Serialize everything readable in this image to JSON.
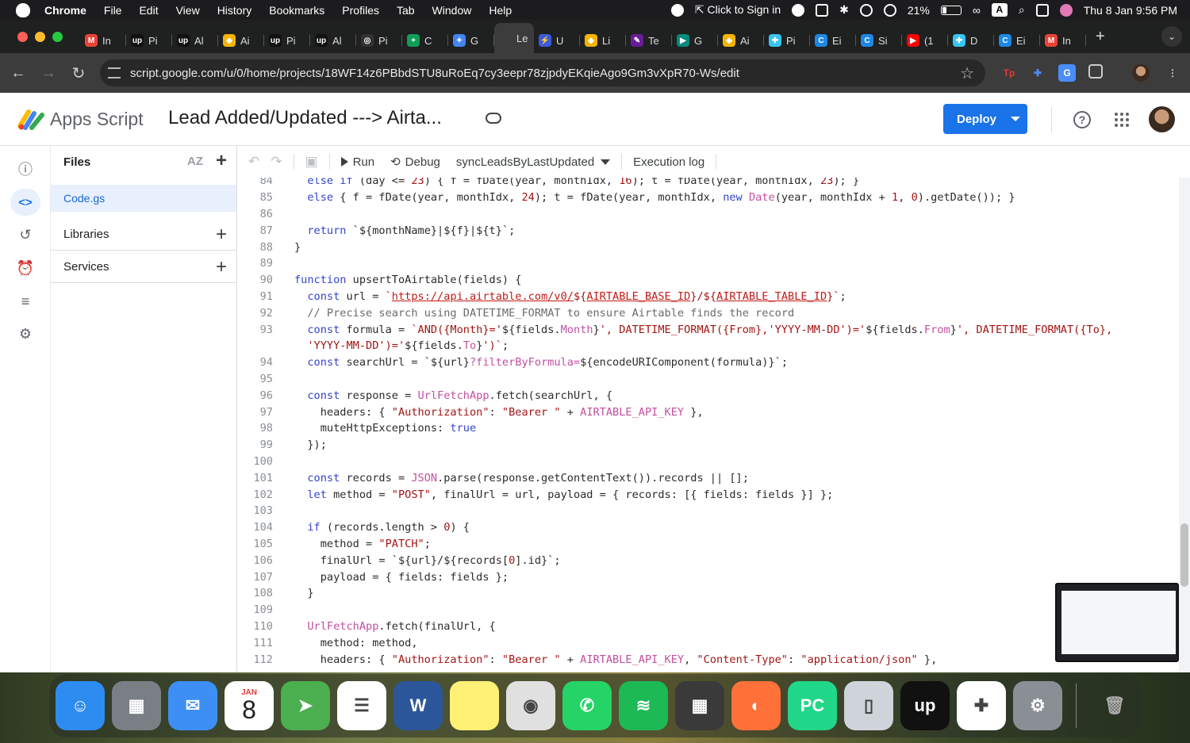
{
  "menubar": {
    "app": "Chrome",
    "items": [
      "File",
      "Edit",
      "View",
      "History",
      "Bookmarks",
      "Profiles",
      "Tab",
      "Window",
      "Help"
    ],
    "sign_in": "Click to Sign in",
    "battery": "21%",
    "input_source": "A",
    "datetime": "Thu 8 Jan  9:56 PM"
  },
  "tabs": [
    {
      "label": "In",
      "icon": "gmail-icon",
      "color": "#ea4335",
      "glyph": "M"
    },
    {
      "label": "Pi",
      "icon": "upwork-icon",
      "color": "#111111",
      "glyph": "up"
    },
    {
      "label": "Al",
      "icon": "upwork-icon",
      "color": "#111111",
      "glyph": "up"
    },
    {
      "label": "Ai",
      "icon": "airtable-icon",
      "color": "#f4b400",
      "glyph": "◆"
    },
    {
      "label": "Pi",
      "icon": "upwork-icon",
      "color": "#111111",
      "glyph": "up"
    },
    {
      "label": "Al",
      "icon": "upwork-icon",
      "color": "#111111",
      "glyph": "up"
    },
    {
      "label": "Pi",
      "icon": "openai-icon",
      "color": "#333333",
      "glyph": "◎"
    },
    {
      "label": "C",
      "icon": "sheets-icon",
      "color": "#0f9d58",
      "glyph": "+"
    },
    {
      "label": "G",
      "icon": "gemini-icon",
      "color": "#4285f4",
      "glyph": "✦"
    },
    {
      "label": "Le",
      "icon": "appsscript-icon",
      "color": "#3c3c3c",
      "glyph": ""
    },
    {
      "label": "U",
      "icon": "zapier-icon",
      "color": "#3b5bdb",
      "glyph": "⚡"
    },
    {
      "label": "Li",
      "icon": "airtable-icon",
      "color": "#f4b400",
      "glyph": "◆"
    },
    {
      "label": "Te",
      "icon": "make-icon",
      "color": "#6a1b9a",
      "glyph": "✎"
    },
    {
      "label": "G",
      "icon": "meet-icon",
      "color": "#00897b",
      "glyph": "▶"
    },
    {
      "label": "Ai",
      "icon": "airtable-icon",
      "color": "#f4b400",
      "glyph": "◆"
    },
    {
      "label": "Pi",
      "icon": "slack-icon",
      "color": "#36c5f0",
      "glyph": "✚"
    },
    {
      "label": "Ei",
      "icon": "chatgpt-icon",
      "color": "#1e88e5",
      "glyph": "C"
    },
    {
      "label": "Si",
      "icon": "chatgpt-icon",
      "color": "#1e88e5",
      "glyph": "C"
    },
    {
      "label": "(1",
      "icon": "youtube-icon",
      "color": "#ff0000",
      "glyph": "▶"
    },
    {
      "label": "D",
      "icon": "slack-icon",
      "color": "#36c5f0",
      "glyph": "✚"
    },
    {
      "label": "Ei",
      "icon": "chatgpt-icon",
      "color": "#1e88e5",
      "glyph": "C"
    },
    {
      "label": "In",
      "icon": "gmail-icon",
      "color": "#ea4335",
      "glyph": "M"
    }
  ],
  "address": {
    "url": "script.google.com/u/0/home/projects/18WF14z6PBbdSTU8uRoEq7cy3eepr78zjpdyEKqieAgo9Gm3vXpR70-Ws/edit"
  },
  "header": {
    "brand": "Apps Script",
    "project_title": "Lead Added/Updated ---> Airta...",
    "deploy_label": "Deploy"
  },
  "files_panel": {
    "title": "Files",
    "file": "Code.gs",
    "libraries": "Libraries",
    "services": "Services"
  },
  "editor_toolbar": {
    "run": "Run",
    "debug": "Debug",
    "function": "syncLeadsByLastUpdated",
    "exec_log": "Execution log"
  },
  "code_lines": [
    {
      "n": "84",
      "html": "  <span class='kw'>else if</span> (day &lt;= <span class='str'>23</span>) { f = fDate(year, monthIdx, <span class='str'>16</span>); t = fDate(year, monthIdx, <span class='str'>23</span>); }"
    },
    {
      "n": "85",
      "html": "  <span class='kw'>else</span> { f = fDate(year, monthIdx, <span class='str'>24</span>); t = fDate(year, monthIdx, <span class='kw'>new</span> <span class='fn'>Date</span>(year, monthIdx + <span class='str'>1</span>, <span class='str'>0</span>).getDate()); }"
    },
    {
      "n": "86",
      "html": ""
    },
    {
      "n": "87",
      "html": "  <span class='kw'>return</span> `${monthName}|${f}|${t}`;"
    },
    {
      "n": "88",
      "html": "}"
    },
    {
      "n": "89",
      "html": ""
    },
    {
      "n": "90",
      "html": "<span class='kw'>function</span> upsertToAirtable(fields) {"
    },
    {
      "n": "91",
      "html": "  <span class='kw'>const</span> url = <span class='str'>`</span><span class='link'>https://api.airtable.com/v0/</span><span class='str'>${</span><span class='link'>AIRTABLE_BASE_ID</span><span class='str'>}/${</span><span class='link'>AIRTABLE_TABLE_ID</span><span class='str'>}`</span>;"
    },
    {
      "n": "92",
      "html": "  <span class='com'>// Precise search using DATETIME_FORMAT to ensure Airtable finds the record</span>"
    },
    {
      "n": "93",
      "html": "  <span class='kw'>const</span> formula = <span class='str'>`AND({Month}='</span>${fields.<span class='fn'>Month</span>}<span class='str'>', DATETIME_FORMAT({From},'YYYY-MM-DD')='</span>${fields.<span class='fn'>From</span>}<span class='str'>', DATETIME_FORMAT({To},</span>"
    },
    {
      "n": "",
      "html": "  <span class='str'>'YYYY-MM-DD')='</span>${fields.<span class='fn'>To</span>}<span class='str'>')`</span>;"
    },
    {
      "n": "94",
      "html": "  <span class='kw'>const</span> searchUrl = `${url}<span class='fn'>?filterByFormula=</span>${encodeURIComponent(formula)}`;"
    },
    {
      "n": "95",
      "html": ""
    },
    {
      "n": "96",
      "html": "  <span class='kw'>const</span> response = <span class='fn'>UrlFetchApp</span>.fetch(searchUrl, {"
    },
    {
      "n": "97",
      "html": "    headers: { <span class='str'>\"Authorization\"</span>: <span class='str'>\"Bearer \"</span> + <span class='fn'>AIRTABLE_API_KEY</span> },"
    },
    {
      "n": "98",
      "html": "    muteHttpExceptions: <span class='kw'>true</span>"
    },
    {
      "n": "99",
      "html": "  });"
    },
    {
      "n": "100",
      "html": ""
    },
    {
      "n": "101",
      "html": "  <span class='kw'>const</span> records = <span class='fn'>JSON</span>.parse(response.getContentText()).records || [];"
    },
    {
      "n": "102",
      "html": "  <span class='kw'>let</span> method = <span class='str'>\"POST\"</span>, finalUrl = url, payload = { records: [{ fields: fields }] };"
    },
    {
      "n": "103",
      "html": ""
    },
    {
      "n": "104",
      "html": "  <span class='kw'>if</span> (records.length &gt; <span class='str'>0</span>) {"
    },
    {
      "n": "105",
      "html": "    method = <span class='str'>\"PATCH\"</span>;"
    },
    {
      "n": "106",
      "html": "    finalUrl = `${url}/${records[<span class='str'>0</span>].id}`;"
    },
    {
      "n": "107",
      "html": "    payload = { fields: fields };"
    },
    {
      "n": "108",
      "html": "  }"
    },
    {
      "n": "109",
      "html": ""
    },
    {
      "n": "110",
      "html": "  <span class='fn'>UrlFetchApp</span>.fetch(finalUrl, {"
    },
    {
      "n": "111",
      "html": "    method: method,"
    },
    {
      "n": "112",
      "html": "    headers: { <span class='str'>\"Authorization\"</span>: <span class='str'>\"Bearer \"</span> + <span class='fn'>AIRTABLE_API_KEY</span>, <span class='str'>\"Content-Type\"</span>: <span class='str'>\"application/json\"</span> },"
    }
  ],
  "dock": {
    "calendar_month": "JAN",
    "calendar_day": "8",
    "apps": [
      {
        "name": "finder-icon",
        "bg": "#2d8cf0",
        "glyph": "☺"
      },
      {
        "name": "launchpad-icon",
        "bg": "#7a7f86",
        "glyph": "▦"
      },
      {
        "name": "mail-icon",
        "bg": "#3d8ff5",
        "glyph": "✉"
      },
      {
        "name": "calendar-icon",
        "bg": "#ffffff",
        "glyph": ""
      },
      {
        "name": "maps-icon",
        "bg": "#4caf50",
        "glyph": "➤"
      },
      {
        "name": "reminders-icon",
        "bg": "#ffffff",
        "glyph": "☰"
      },
      {
        "name": "word-icon",
        "bg": "#2b579a",
        "glyph": "W"
      },
      {
        "name": "notes-icon",
        "bg": "#fff176",
        "glyph": ""
      },
      {
        "name": "chrome-icon",
        "bg": "#e0e0e0",
        "glyph": "◉"
      },
      {
        "name": "whatsapp-icon",
        "bg": "#25d366",
        "glyph": "✆"
      },
      {
        "name": "spotify-icon",
        "bg": "#1db954",
        "glyph": "≋"
      },
      {
        "name": "calculator-icon",
        "bg": "#3a3a3a",
        "glyph": "▦"
      },
      {
        "name": "firefox-icon",
        "bg": "#ff7139",
        "glyph": "◐"
      },
      {
        "name": "pycharm-icon",
        "bg": "#21d789",
        "glyph": "PC"
      },
      {
        "name": "iphone-mirroring-icon",
        "bg": "#cfd4da",
        "glyph": "▯"
      },
      {
        "name": "upwork-icon",
        "bg": "#111111",
        "glyph": "up"
      },
      {
        "name": "slack-icon",
        "bg": "#ffffff",
        "glyph": "✚"
      },
      {
        "name": "system-settings-icon",
        "bg": "#8a8f96",
        "glyph": "⚙"
      }
    ]
  }
}
